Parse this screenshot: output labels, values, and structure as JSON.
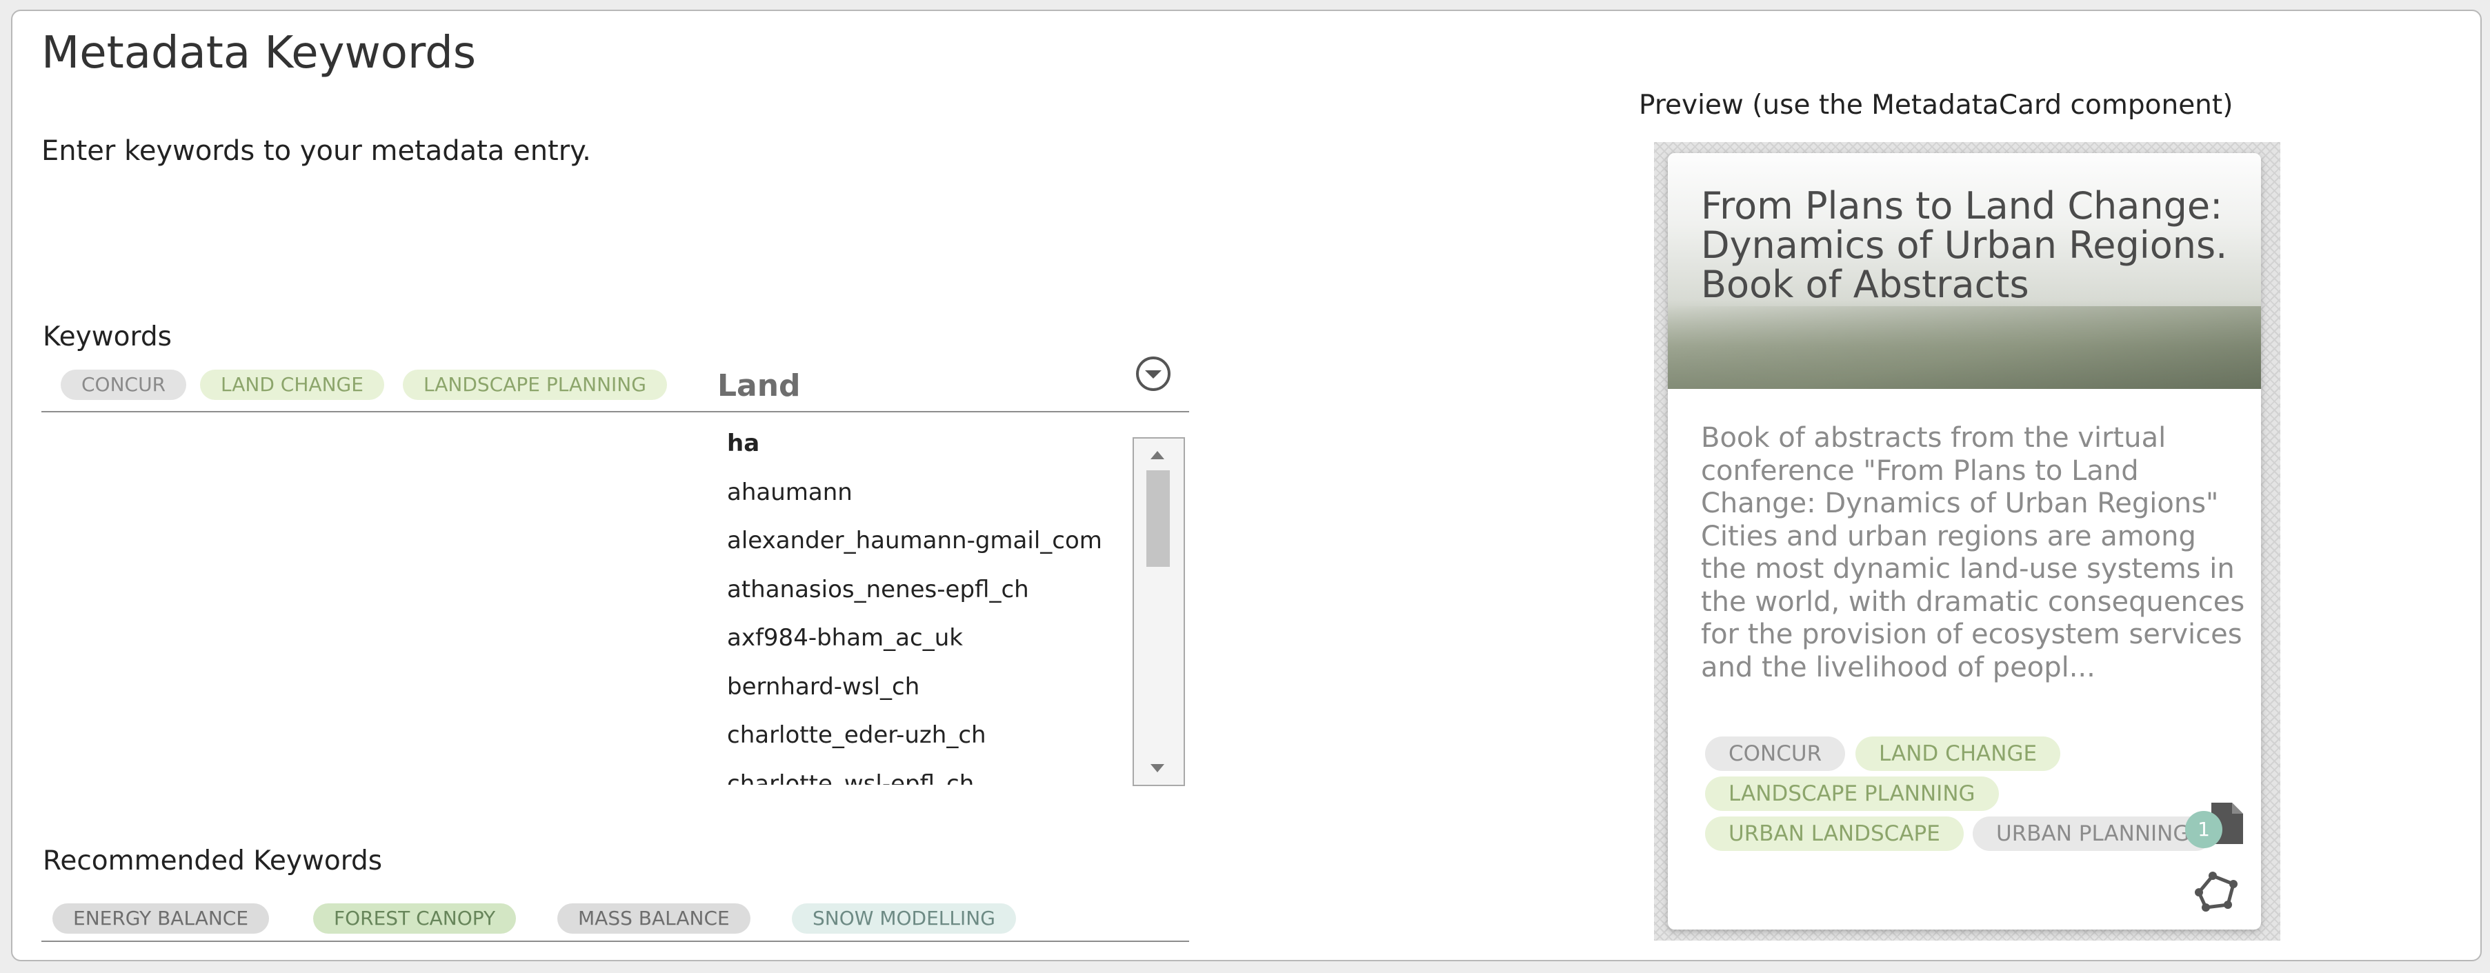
{
  "page": {
    "title": "Metadata Keywords",
    "intro": "Enter keywords to your metadata entry."
  },
  "keywords": {
    "label": "Keywords",
    "selected": [
      "CONCUR",
      "LAND CHANGE",
      "LANDSCAPE PLANNING"
    ],
    "input_value": "Land",
    "suggestions": [
      "ha",
      "ahaumann",
      "alexander_haumann-gmail_com",
      "athanasios_nenes-epfl_ch",
      "axf984-bham_ac_uk",
      "bernhard-wsl_ch",
      "charlotte_eder-uzh_ch",
      "charlotte_wsl-epfl_ch"
    ]
  },
  "recommended": {
    "label": "Recommended Keywords",
    "items": [
      "ENERGY BALANCE",
      "FOREST CANOPY",
      "MASS BALANCE",
      "SNOW MODELLING"
    ]
  },
  "preview": {
    "heading": "Preview  (use the MetadataCard component)",
    "card": {
      "title": "From Plans to Land Change: Dynamics of Urban Regions. Book of Abstracts",
      "abstract": "Book of abstracts from the virtual conference \"From Plans to Land Change: Dynamics of Urban Regions\" Cities and urban regions are among the most dynamic land-use systems in the world, with dramatic consequences for the provision of ecosystem services and the livelihood of peopl...",
      "tags": [
        "CONCUR",
        "LAND CHANGE",
        "LANDSCAPE PLANNING",
        "URBAN LANDSCAPE",
        "URBAN PLANNING"
      ],
      "resource_count": "1"
    }
  },
  "icons": {
    "dropdown_toggle": "chevron-circle-down-icon",
    "resource": "file-icon",
    "network": "network-icon"
  },
  "colors": {
    "chip_grey": "#e3e3e3",
    "chip_green": "#e8f2d7",
    "badge": "#98c9b9"
  }
}
